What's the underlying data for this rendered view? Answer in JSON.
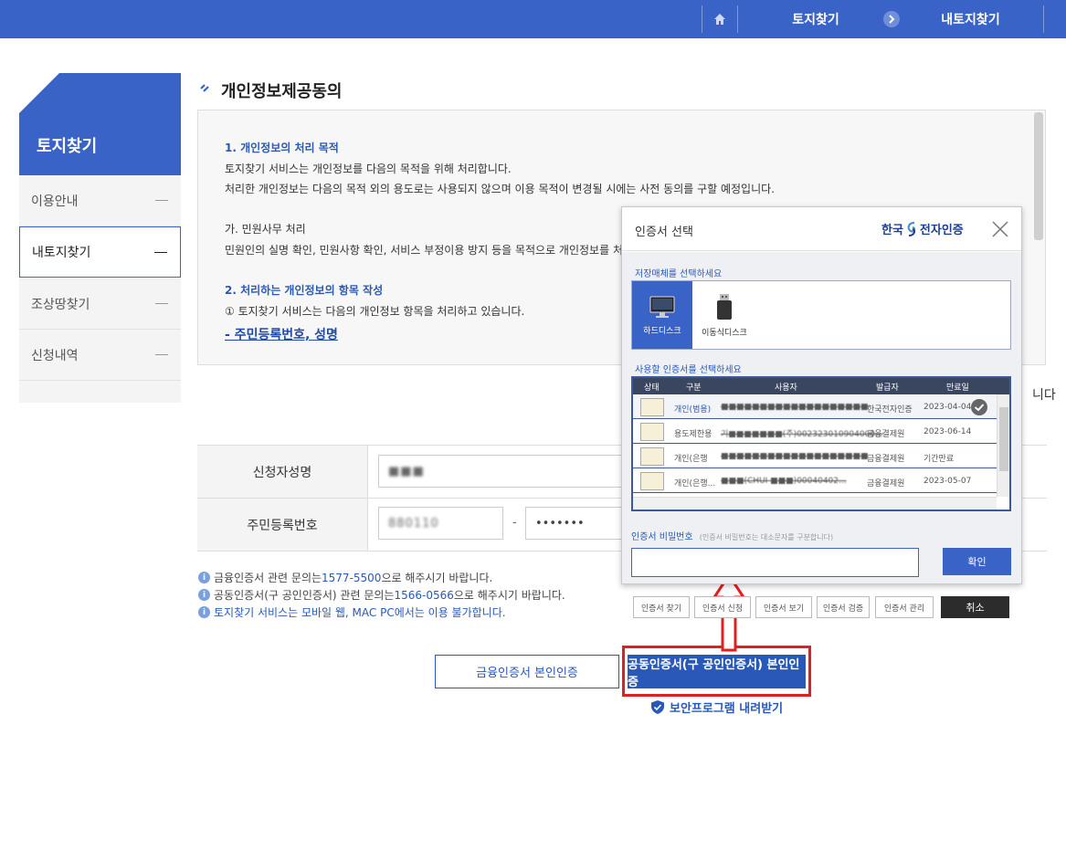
{
  "topbar": {
    "home_icon": "home-icon",
    "crumb1": "토지찾기",
    "crumb_arrow_icon": "chevron-right-icon",
    "crumb2": "내토지찾기",
    "color": "#3a63c7"
  },
  "sidebar": {
    "title": "토지찾기",
    "items": [
      {
        "label": "이용안내",
        "active": false
      },
      {
        "label": "내토지찾기",
        "active": true
      },
      {
        "label": "조상땅찾기",
        "active": false
      },
      {
        "label": "신청내역",
        "active": false
      }
    ]
  },
  "section": {
    "title": "개인정보제공동의"
  },
  "agreement": {
    "p1_head": "1. 개인정보의 처리 목적",
    "p1_l1": "토지찾기 서비스는 개인정보를 다음의 목적을 위해 처리합니다.",
    "p1_l2": "처리한 개인정보는 다음의 목적 외의 용도로는 사용되지 않으며 이용 목적이 변경될 시에는 사전 동의를 구할 예정입니다.",
    "p2_head": "가. 민원사무 처리",
    "p2_l1": "민원인의 실명 확인, 민원사항 확인, 서비스 부정이용 방지 등을 목적으로 개인정보를 처",
    "p3_head": "2. 처리하는 개인정보의 항목 작성",
    "p3_l1": "① 토지찾기 서비스는 다음의 개인정보 항목을 처리하고 있습니다.",
    "p3_link": "- 주민등록번호, 성명"
  },
  "behind_text": "니다",
  "form": {
    "name_label": "신청자성명",
    "name_value": "■■■",
    "rrn_label": "주민등록번호",
    "rrn_front": "880110",
    "rrn_dash": "-",
    "rrn_back": "•••••••"
  },
  "notes": [
    {
      "pre": "금융인증서 관련 문의는 ",
      "num": "1577-5500",
      "post": " 으로 해주시기 바랍니다."
    },
    {
      "pre": "공동인증서(구 공인인증서) 관련 문의는 ",
      "num": "1566-0566",
      "post": " 으로 해주시기 바랍니다."
    },
    {
      "text": "토지찾기 서비스는 모바일 웹, MAC PC에서는 이용 불가합니다."
    }
  ],
  "buttons": {
    "financial_cert": "금융인증서 본인인증",
    "public_cert": "공동인증서(구 공인인증서) 본인인증",
    "download": "보안프로그램 내려받기"
  },
  "dialog": {
    "title": "인증서 선택",
    "logo_text_a": "한국",
    "logo_text_b": "전자인증",
    "storage_label": "저장매체를 선택하세요",
    "storage": [
      {
        "label": "하드디스크",
        "icon": "monitor-icon",
        "selected": true
      },
      {
        "label": "이동식디스크",
        "icon": "usb-icon",
        "selected": false
      }
    ],
    "cert_label": "사용할 인증서를 선택하세요",
    "columns": [
      "상태",
      "구분",
      "사용자",
      "발급자",
      "만료일"
    ],
    "rows": [
      {
        "type": "개인(범용)",
        "user": "■■■■■■■■■■■■■■■■■■■",
        "issuer": "한국전자인증",
        "expiry": "2023-04-04"
      },
      {
        "type": "용도제한용",
        "user": "기■■■■■■■(주)002323010904000...",
        "issuer": "금융결제원",
        "expiry": "2023-06-14"
      },
      {
        "type": "개인(은행",
        "user": "■■■■■■■■■■■■■■■■■■■",
        "issuer": "금융결제원",
        "expiry": "기간만료"
      },
      {
        "type": "개인(은행...",
        "user": "■■■(CHUI ■■■)00040402...",
        "issuer": "금융결제원",
        "expiry": "2023-05-07"
      }
    ],
    "pw_label": "인증서 비밀번호",
    "pw_hint": "(인증서 비밀번호는 대소문자를 구분합니다)",
    "ok": "확인",
    "bottom_buttons": [
      "인증서 찾기",
      "인증서 신청",
      "인증서 보기",
      "인증서 검증",
      "인증서 관리"
    ],
    "cancel": "취소"
  }
}
